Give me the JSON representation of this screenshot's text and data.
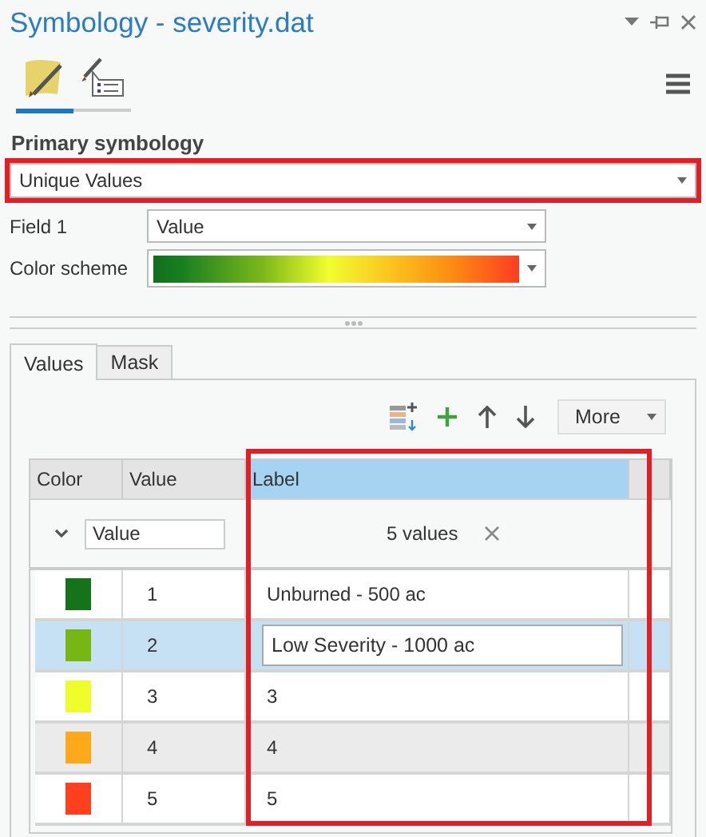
{
  "window": {
    "title": "Symbology - severity.dat"
  },
  "view_tabs": [
    {
      "kind": "primary",
      "selected": true
    },
    {
      "kind": "labels",
      "selected": false
    }
  ],
  "primary_symbology": {
    "heading": "Primary symbology",
    "value": "Unique Values"
  },
  "field_1": {
    "label": "Field 1",
    "value": "Value"
  },
  "color_scheme": {
    "label": "Color scheme"
  },
  "tabs": [
    {
      "label": "Values",
      "selected": true
    },
    {
      "label": "Mask",
      "selected": false
    }
  ],
  "toolbar": {
    "more": "More"
  },
  "table": {
    "columns": [
      "Color",
      "Value",
      "Label"
    ],
    "group": {
      "field": "Value",
      "count": "5 values"
    },
    "rows": [
      {
        "color": "#15731a",
        "value": "1",
        "label": "Unburned - 500 ac",
        "selected": false
      },
      {
        "color": "#78b614",
        "value": "2",
        "label": "Low Severity - 1000 ac",
        "selected": true
      },
      {
        "color": "#eefe2a",
        "value": "3",
        "label": "3",
        "selected": false
      },
      {
        "color": "#fda919",
        "value": "4",
        "label": "4",
        "selected": false
      },
      {
        "color": "#ff3f1d",
        "value": "5",
        "label": "5",
        "selected": false
      }
    ]
  }
}
